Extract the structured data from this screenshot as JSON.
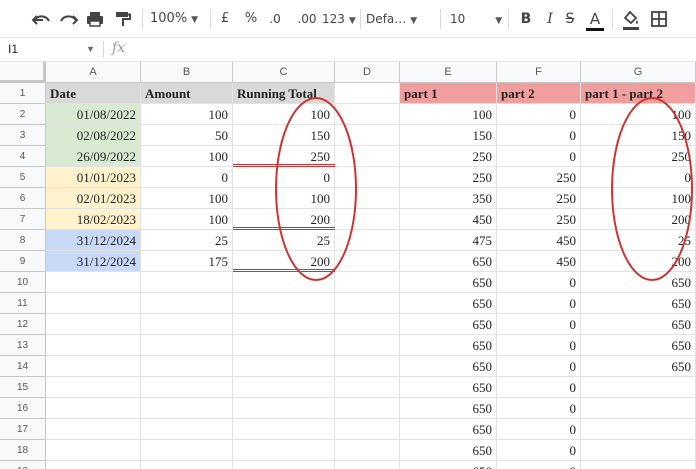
{
  "toolbar": {
    "zoom": "100%",
    "currency": "£",
    "percent": "%",
    "dec_decrease": ".0",
    "dec_increase": ".00",
    "more_formats": "123",
    "font": "Defa…",
    "font_size": "10",
    "bold": "B",
    "italic": "I",
    "strike": "S",
    "text_color": "A"
  },
  "formula_bar": {
    "name_box": "I1",
    "fx": "fx",
    "formula": ""
  },
  "columns": [
    "A",
    "B",
    "C",
    "D",
    "E",
    "F",
    "G"
  ],
  "rows": [
    "1",
    "2",
    "3",
    "4",
    "5",
    "6",
    "7",
    "8",
    "9",
    "10",
    "11",
    "12",
    "13",
    "14",
    "15",
    "16",
    "17",
    "18",
    "19"
  ],
  "left_table": {
    "headers": [
      "Date",
      "Amount",
      "Running Total"
    ],
    "rows": [
      [
        "01/08/2022",
        "100",
        "100"
      ],
      [
        "02/08/2022",
        "50",
        "150"
      ],
      [
        "26/09/2022",
        "100",
        "250"
      ],
      [
        "01/01/2023",
        "0",
        "0"
      ],
      [
        "02/01/2023",
        "100",
        "100"
      ],
      [
        "18/02/2023",
        "100",
        "200"
      ],
      [
        "31/12/2024",
        "25",
        "25"
      ],
      [
        "31/12/2024",
        "175",
        "200"
      ]
    ]
  },
  "right_table": {
    "headers": [
      "part 1",
      "part 2",
      "part 1 - part 2"
    ],
    "rows": [
      [
        "100",
        "0",
        "100"
      ],
      [
        "150",
        "0",
        "150"
      ],
      [
        "250",
        "0",
        "250"
      ],
      [
        "250",
        "250",
        "0"
      ],
      [
        "350",
        "250",
        "100"
      ],
      [
        "450",
        "250",
        "200"
      ],
      [
        "475",
        "450",
        "25"
      ],
      [
        "650",
        "450",
        "200"
      ],
      [
        "650",
        "0",
        "650"
      ],
      [
        "650",
        "0",
        "650"
      ],
      [
        "650",
        "0",
        "650"
      ],
      [
        "650",
        "0",
        "650"
      ],
      [
        "650",
        "0",
        "650"
      ],
      [
        "650",
        "0",
        ""
      ],
      [
        "650",
        "0",
        ""
      ],
      [
        "650",
        "0",
        ""
      ],
      [
        "650",
        "0",
        ""
      ],
      [
        "650",
        "0",
        ""
      ]
    ]
  },
  "colors": {
    "header_grey": "#d9d9d9",
    "header_red": "#f19e9e",
    "date_green": "#d9ead3",
    "date_yellow": "#fff2cc",
    "date_blue": "#c9daf8",
    "annotation_red": "#cc3333"
  }
}
